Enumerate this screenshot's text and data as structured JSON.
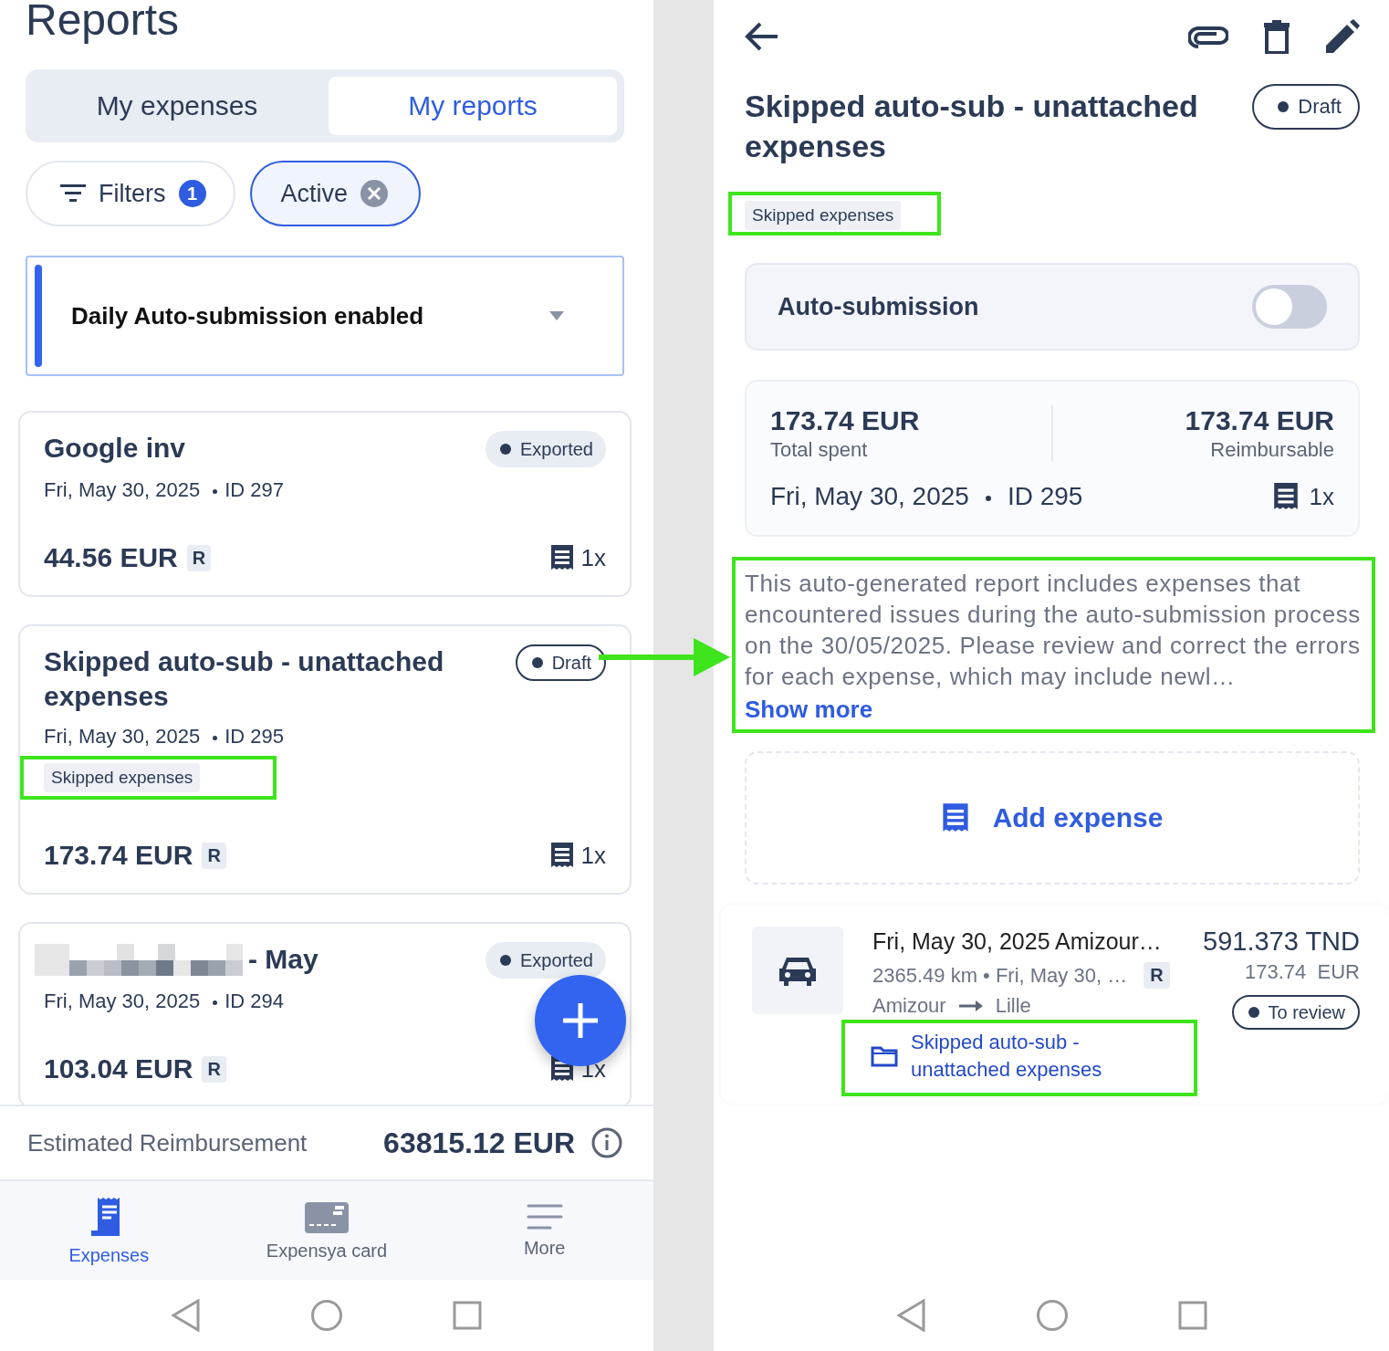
{
  "left_screen": {
    "title": "Reports",
    "tabs": [
      {
        "label": "My expenses",
        "selected": false
      },
      {
        "label": "My reports",
        "selected": true
      }
    ],
    "filters": [
      {
        "kind": "filter",
        "label": "Filters",
        "count": "1",
        "selected": false
      },
      {
        "kind": "status",
        "label": "Active",
        "selected": true
      }
    ],
    "banner": {
      "text": "Daily Auto-submission enabled"
    },
    "reports": [
      {
        "title": "Google inv",
        "redacted": false,
        "status": {
          "label": "Exported",
          "kind": "filled"
        },
        "date": "Fri, May 30, 2025",
        "id": "ID 297",
        "amount": "44.56 EUR",
        "badge": "R",
        "receipts": "1x"
      },
      {
        "title": "Skipped auto-sub - unattached expenses",
        "redacted": false,
        "status": {
          "label": "Draft",
          "kind": "outlined"
        },
        "date": "Fri, May 30, 2025",
        "id": "ID 295",
        "tags": [
          {
            "label": "Skipped expenses",
            "highlighted": true
          }
        ],
        "amount": "173.74 EUR",
        "badge": "R",
        "receipts": "1x"
      },
      {
        "title": "- May",
        "redacted": true,
        "status": {
          "label": "Exported",
          "kind": "filled"
        },
        "date": "Fri, May 30, 2025",
        "id": "ID 294",
        "amount": "103.04 EUR",
        "badge": "R",
        "receipts": "1x"
      }
    ],
    "estimated": {
      "label": "Estimated Reimbursement",
      "amount": "63815.12 EUR"
    },
    "nav": [
      {
        "label": "Expenses",
        "kind": "receipt",
        "selected": true
      },
      {
        "label": "Expensya card",
        "kind": "card",
        "selected": false
      },
      {
        "label": "More",
        "kind": "menu",
        "selected": false
      }
    ]
  },
  "right_screen": {
    "title": "Skipped auto-sub - unattached expenses",
    "status": {
      "label": "Draft",
      "kind": "outlined"
    },
    "tags": [
      {
        "label": "Skipped expenses",
        "highlighted": true
      }
    ],
    "auto_submission": {
      "label": "Auto-submission",
      "on": false
    },
    "summary": {
      "total": "173.74 EUR",
      "total_label": "Total spent",
      "reimbursable": "173.74 EUR",
      "reimbursable_label": "Reimbursable",
      "date": "Fri, May 30, 2025",
      "id": "ID 295",
      "receipts": "1x"
    },
    "description": {
      "text": "This auto-generated report includes expenses that encountered issues during the auto-submission process on the 30/05/2025. Please review and correct the errors for each expense, which may include newl…",
      "link": "Show more",
      "highlighted": true
    },
    "add_expense": "Add expense",
    "expenses": [
      {
        "title": "Fri, May 30, 2025 Amizour…",
        "details": "2365.49 km • Fri, May 30, …",
        "badge": "R",
        "from": "Amizour",
        "to": "Lille",
        "amount": "591.373 TND",
        "converted": "173.74  EUR",
        "status": {
          "label": "To review",
          "kind": "outlined"
        },
        "report": {
          "label": "Skipped auto-sub - unattached expenses",
          "highlighted": true
        }
      }
    ]
  }
}
